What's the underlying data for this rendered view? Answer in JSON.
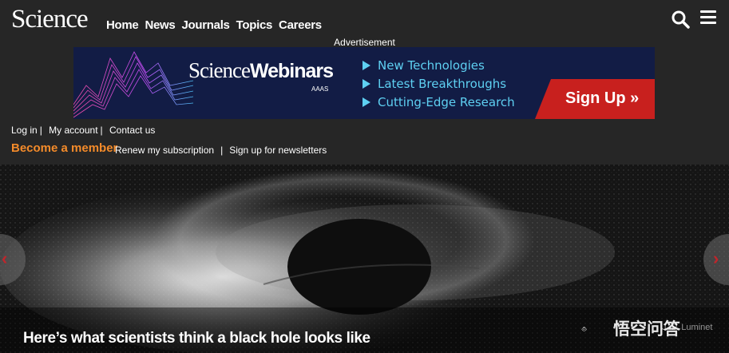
{
  "header": {
    "logo": "Science",
    "nav": [
      "Home",
      "News",
      "Journals",
      "Topics",
      "Careers"
    ]
  },
  "ad": {
    "label": "Advertisement",
    "brand_a": "Science",
    "brand_b": "Webinars",
    "aaas": "AAAS",
    "items": [
      "New Technologies",
      "Latest Breakthroughs",
      "Cutting-Edge Research"
    ],
    "cta": "Sign Up »",
    "colors": {
      "background": "#121c45",
      "accent": "#5ed0f2",
      "cta": "#c8201e"
    }
  },
  "account": {
    "links": [
      "Log in",
      "My account",
      "Contact us"
    ],
    "become_member": "Become a member",
    "renew": "Renew my subscription",
    "newsletters": "Sign up for newsletters",
    "member_color": "#f48b2a"
  },
  "hero": {
    "caption": "Here’s what scientists think a black hole looks like",
    "prev": "‹",
    "next": "›"
  },
  "watermark": {
    "text": "悟空问答",
    "sub": "J.-P. Luminet"
  }
}
